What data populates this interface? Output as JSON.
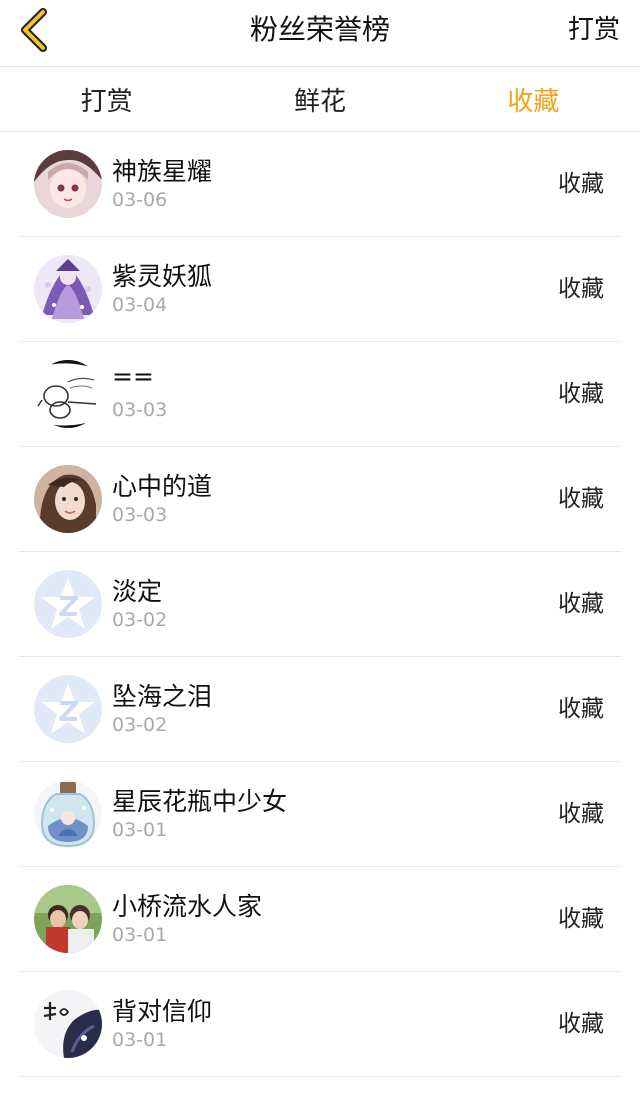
{
  "nav": {
    "title": "粉丝荣誉榜",
    "right_label": "打赏",
    "back_icon": "chevron-left-icon",
    "accent_color": "#f3a21b"
  },
  "tabs": [
    {
      "label": "打赏",
      "active": false
    },
    {
      "label": "鲜花",
      "active": false
    },
    {
      "label": "收藏",
      "active": true
    }
  ],
  "fans": [
    {
      "name": "神族星耀",
      "date": "03-06",
      "action": "收藏",
      "avatar": "anime-girl-avatar"
    },
    {
      "name": "紫灵妖狐",
      "date": "03-04",
      "action": "收藏",
      "avatar": "purple-anime-avatar"
    },
    {
      "name": "==",
      "date": "03-03",
      "action": "收藏",
      "avatar": "sketch-avatar"
    },
    {
      "name": "心中的道",
      "date": "03-03",
      "action": "收藏",
      "avatar": "photo-avatar"
    },
    {
      "name": "淡定",
      "date": "03-02",
      "action": "收藏",
      "avatar": "default-qzone-avatar"
    },
    {
      "name": "坠海之泪",
      "date": "03-02",
      "action": "收藏",
      "avatar": "default-qzone-avatar"
    },
    {
      "name": "星辰花瓶中少女",
      "date": "03-01",
      "action": "收藏",
      "avatar": "bottle-girl-avatar"
    },
    {
      "name": "小桥流水人家",
      "date": "03-01",
      "action": "收藏",
      "avatar": "couple-photo-avatar"
    },
    {
      "name": "背对信仰",
      "date": "03-01",
      "action": "收藏",
      "avatar": "ink-calligraphy-avatar"
    }
  ]
}
